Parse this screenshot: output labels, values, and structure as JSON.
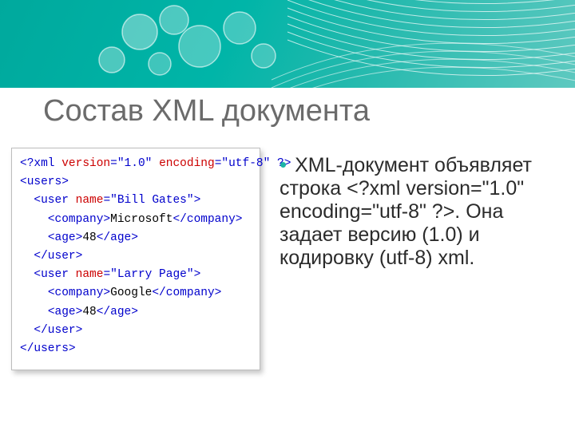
{
  "slide": {
    "title": "Состав XML документа",
    "bullet": "XML-документ объявляет строка <?xml version=\"1.0\" encoding=\"utf-8\" ?>. Она задает версию (1.0) и кодировку (utf-8) xml.",
    "code": {
      "lang": "xml",
      "lines": [
        {
          "type": "decl",
          "pre": "<?",
          "tag": "xml",
          "attrs": [
            [
              "version",
              "1.0"
            ],
            [
              "encoding",
              "utf-8"
            ]
          ],
          "post": " ?>"
        },
        {
          "type": "open",
          "tag": "users",
          "indent": 0
        },
        {
          "type": "open",
          "tag": "user",
          "attrs": [
            [
              "name",
              "Bill Gates"
            ]
          ],
          "indent": 1
        },
        {
          "type": "elem",
          "tag": "company",
          "text": "Microsoft",
          "indent": 2
        },
        {
          "type": "elem",
          "tag": "age",
          "text": "48",
          "indent": 2
        },
        {
          "type": "close",
          "tag": "user",
          "indent": 1
        },
        {
          "type": "open",
          "tag": "user",
          "attrs": [
            [
              "name",
              "Larry Page"
            ]
          ],
          "indent": 1
        },
        {
          "type": "elem",
          "tag": "company",
          "text": "Google",
          "indent": 2
        },
        {
          "type": "elem",
          "tag": "age",
          "text": "48",
          "indent": 2
        },
        {
          "type": "close",
          "tag": "user",
          "indent": 1
        },
        {
          "type": "close",
          "tag": "users",
          "indent": 0
        }
      ]
    }
  }
}
